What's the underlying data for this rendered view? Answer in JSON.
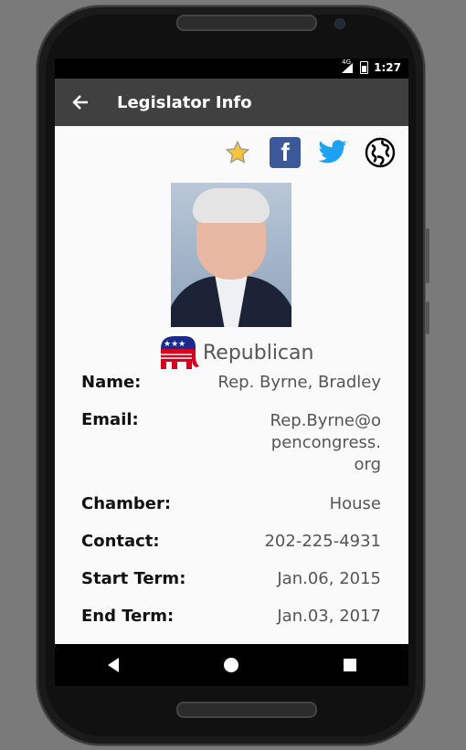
{
  "status": {
    "network": "4G",
    "time": "1:27"
  },
  "appbar": {
    "title": "Legislator Info"
  },
  "actions": {
    "favorite": "star-icon",
    "facebook": "facebook-icon",
    "twitter": "twitter-icon",
    "website": "globe-icon"
  },
  "legislator": {
    "party": "Republican",
    "fields": [
      {
        "label": "Name:",
        "value": "Rep. Byrne, Bradley"
      },
      {
        "label": "Email:",
        "value": "Rep.Byrne@opencongress.org"
      },
      {
        "label": "Chamber:",
        "value": "House"
      },
      {
        "label": "Contact:",
        "value": "202-225-4931"
      },
      {
        "label": "Start Term:",
        "value": "Jan.06, 2015"
      },
      {
        "label": "End Term:",
        "value": "Jan.03, 2017"
      }
    ]
  },
  "colors": {
    "appbar": "#404040",
    "facebook": "#3b5998",
    "twitter": "#1da1f2",
    "republican_red": "#d6001c",
    "republican_blue": "#1b2a8c"
  }
}
